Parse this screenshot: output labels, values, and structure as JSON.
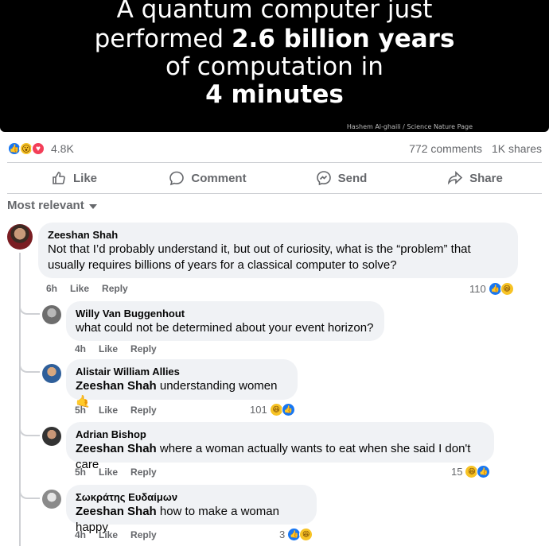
{
  "hero": {
    "line1": "A quantum computer just",
    "line2_pre": "performed ",
    "line2_bold": "2.6 billion years",
    "line3": "of computation in",
    "line4": "4 minutes",
    "credit": "Hashem Al-ghaili / Science Nature Page"
  },
  "stats": {
    "reactions_count": "4.8K",
    "comments": "772 comments",
    "shares": "1K shares",
    "reaction_icons": [
      "like-icon",
      "wow-icon",
      "love-icon"
    ]
  },
  "actions": [
    {
      "label": "Like",
      "icon": "thumbs-up-icon"
    },
    {
      "label": "Comment",
      "icon": "comment-icon"
    },
    {
      "label": "Send",
      "icon": "messenger-icon"
    },
    {
      "label": "Share",
      "icon": "share-icon"
    }
  ],
  "sort": {
    "label": "Most relevant"
  },
  "comments": [
    {
      "author": "Zeeshan Shah",
      "text": "Not that I’d probably understand it, but out of curiosity, what is the “problem” that usually requires billions of years for a classical computer to solve?",
      "time": "6h",
      "like": "Like",
      "reply": "Reply",
      "reaction_count": "110"
    },
    {
      "author": "Willy Van Buggenhout",
      "text": "what could not be determined about your event horizon?",
      "time": "4h",
      "like": "Like",
      "reply": "Reply",
      "reaction_count": ""
    },
    {
      "author": "Alistair William Allies",
      "tag": "Zeeshan Shah",
      "text": " understanding women ",
      "emoji": "🤙",
      "time": "5h",
      "like": "Like",
      "reply": "Reply",
      "reaction_count": "101"
    },
    {
      "author": "Adrian Bishop",
      "tag": "Zeeshan Shah",
      "text": " where a woman actually wants to eat when she said I don't care",
      "time": "5h",
      "like": "Like",
      "reply": "Reply",
      "reaction_count": "15"
    },
    {
      "author": "Σωκράτης Ευδαίμων",
      "tag": "Zeeshan Shah",
      "text": " how to make a woman happy",
      "time": "4h",
      "like": "Like",
      "reply": "Reply",
      "reaction_count": "3"
    }
  ],
  "colors": {
    "like_blue": "#1877f2",
    "bubble_bg": "#f0f2f5",
    "secondary_text": "#65676b"
  }
}
